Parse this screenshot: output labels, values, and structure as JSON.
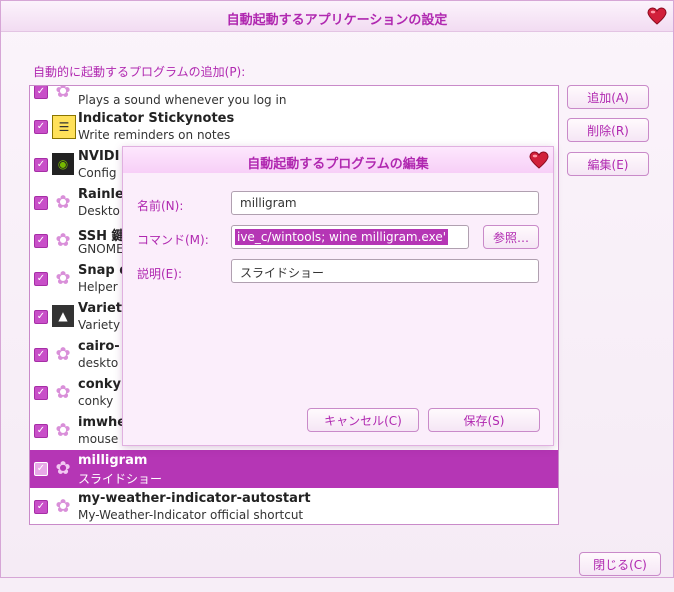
{
  "window": {
    "title": "自動起動するアプリケーションの設定",
    "list_label": "自動的に起動するプログラムの追加(P):",
    "buttons": {
      "add": "追加(A)",
      "remove": "削除(R)",
      "edit": "編集(E)",
      "close": "閉じる(C)"
    }
  },
  "programs": [
    {
      "name": "",
      "desc": "Plays a sound whenever you log in",
      "icon": "flower-icon",
      "checked": true
    },
    {
      "name": "Indicator Stickynotes",
      "desc": "Write reminders on notes",
      "icon": "sticky-notes-icon",
      "checked": true
    },
    {
      "name": "NVIDI",
      "desc": "Config",
      "icon": "nvidia-icon",
      "checked": true
    },
    {
      "name": "Rainle",
      "desc": "Deskto",
      "icon": "flower-icon",
      "checked": true
    },
    {
      "name": "SSH 鍵",
      "desc": "GNOME",
      "icon": "flower-icon",
      "checked": true
    },
    {
      "name": "Snap d",
      "desc": "Helper",
      "icon": "flower-icon",
      "checked": true
    },
    {
      "name": "Variet",
      "desc": "Variety",
      "icon": "variety-icon",
      "checked": true
    },
    {
      "name": "cairo-",
      "desc": "deskto",
      "icon": "flower-icon",
      "checked": true
    },
    {
      "name": "conky",
      "desc": "conky",
      "icon": "flower-icon",
      "checked": true
    },
    {
      "name": "imwhee",
      "desc": "mouse s",
      "icon": "flower-icon",
      "checked": true
    },
    {
      "name": "milligram",
      "desc": "スライドショー",
      "icon": "flower-icon",
      "checked": true
    },
    {
      "name": "my-weather-indicator-autostart",
      "desc": "My-Weather-Indicator official shortcut",
      "icon": "flower-icon",
      "checked": true
    }
  ],
  "dialog": {
    "title": "自動起動するプログラムの編集",
    "name_label": "名前(N):",
    "name_value": "milligram",
    "command_label": "コマンド(M):",
    "command_value": "ive_c/wintools; wine milligram.exe'",
    "browse_button": "参照…",
    "comment_label": "説明(E):",
    "comment_value": "スライドショー",
    "cancel_button": "キャンセル(C)",
    "save_button": "保存(S)"
  },
  "colors": {
    "accent": "#b536b5",
    "label": "#b028b0",
    "heart": "#d11f3a"
  }
}
